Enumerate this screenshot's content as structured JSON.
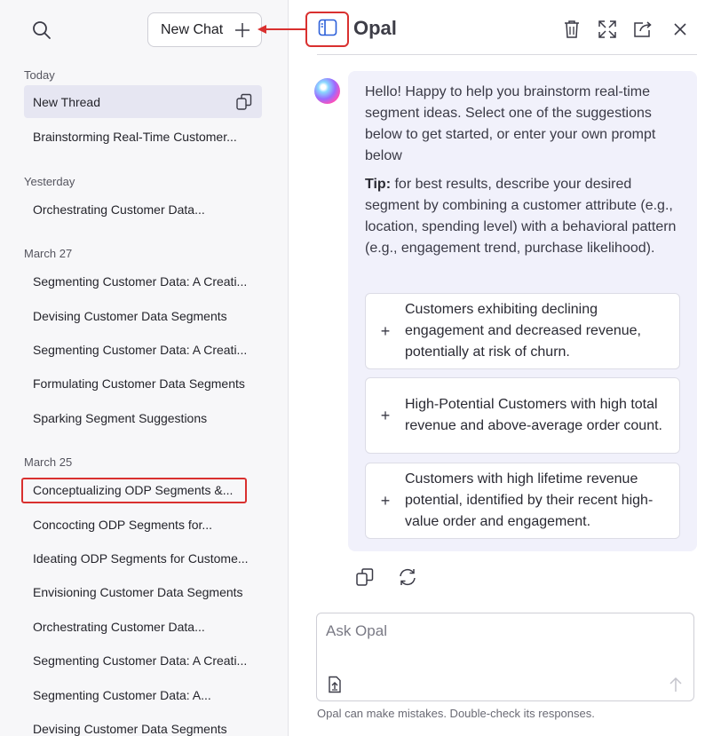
{
  "sidebar": {
    "new_chat_label": "New Chat",
    "sections": {
      "today": {
        "label": "Today",
        "items": [
          "New Thread",
          "Brainstorming Real-Time Customer..."
        ]
      },
      "yesterday": {
        "label": "Yesterday",
        "items": [
          "Orchestrating Customer Data..."
        ]
      },
      "march27": {
        "label": "March 27",
        "items": [
          "Segmenting Customer Data: A Creati...",
          "Devising Customer Data Segments",
          "Segmenting Customer Data: A Creati...",
          "Formulating Customer Data Segments",
          "Sparking Segment Suggestions"
        ]
      },
      "march25": {
        "label": "March 25",
        "items": [
          "Conceptualizing ODP Segments &...",
          "Concocting ODP Segments for...",
          "Ideating ODP Segments for Custome...",
          "Envisioning Customer Data Segments",
          "Orchestrating Customer Data...",
          "Segmenting Customer Data: A Creati...",
          "Segmenting Customer Data: A...",
          "Devising Customer Data Segments"
        ]
      }
    }
  },
  "header": {
    "title": "Opal",
    "icons": [
      "sidebar-toggle-icon",
      "trash-icon",
      "expand-icon",
      "share-icon",
      "close-icon"
    ]
  },
  "message": {
    "intro": "Hello! Happy to help you brainstorm real-time segment ideas. Select one of the suggestions below to get started, or enter your own prompt below",
    "tip_label": "Tip:",
    "tip_text": " for best results, describe your desired segment by combining a customer attribute (e.g., location, spending level) with a behavioral pattern (e.g., engagement trend, purchase likelihood).",
    "suggestions": [
      "Customers exhibiting declining engagement and decreased revenue, potentially at risk of churn.",
      "High-Potential Customers with high total revenue and above-average order count.",
      "Customers with high lifetime revenue potential, identified by their recent high-value order and engagement."
    ],
    "suggestion_icon": "+"
  },
  "composer": {
    "placeholder": "Ask Opal",
    "disclaimer": "Opal can make mistakes. Double-check its responses."
  },
  "colors": {
    "annotation_red": "#d9302f",
    "accent_blue": "#2b5fd9",
    "active_thread_bg": "#e6e6f2",
    "bubble_bg": "#f1f1fb"
  }
}
